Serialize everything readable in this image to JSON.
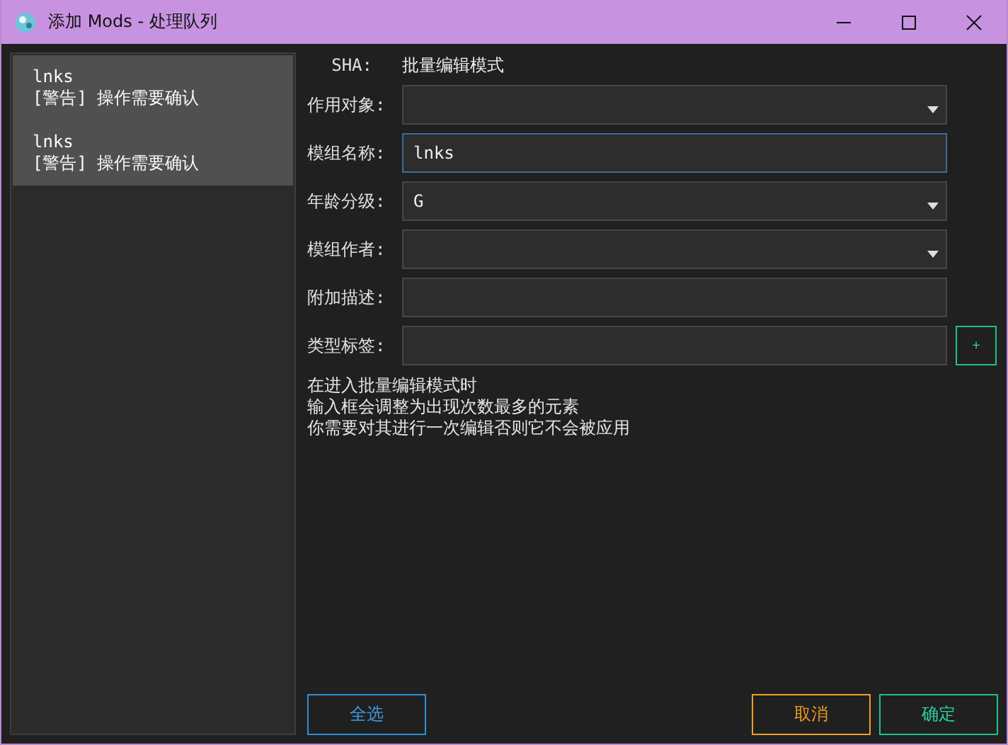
{
  "window": {
    "title": "添加 Mods - 处理队列"
  },
  "queue": [
    {
      "name": "lnks",
      "status": "[警告] 操作需要确认",
      "selected": true
    },
    {
      "name": "lnks",
      "status": "[警告] 操作需要确认",
      "selected": true
    }
  ],
  "sha": {
    "label": "SHA:",
    "value": "批量编辑模式"
  },
  "fields": [
    {
      "label": "作用对象:",
      "kind": "dropdown",
      "focused": false
    },
    {
      "label": "模组名称:",
      "kind": "text",
      "value": "lnks",
      "focused": true
    },
    {
      "label": "年龄分级:",
      "kind": "dropdown",
      "value": "G",
      "focused": false
    },
    {
      "label": "模组作者:",
      "kind": "dropdown",
      "focused": false
    },
    {
      "label": "附加描述:",
      "kind": "text",
      "focused": false
    },
    {
      "label": "类型标签:",
      "kind": "tags",
      "add_button": "+",
      "focused": false
    }
  ],
  "notes": [
    "在进入批量编辑模式时",
    "输入框会调整为出现次数最多的元素",
    "你需要对其进行一次编辑否则它不会被应用"
  ],
  "buttons": [
    {
      "label": "全选",
      "kind": "select_all"
    },
    {
      "label": "取消",
      "kind": "cancel"
    },
    {
      "label": "确定",
      "kind": "confirm"
    }
  ]
}
